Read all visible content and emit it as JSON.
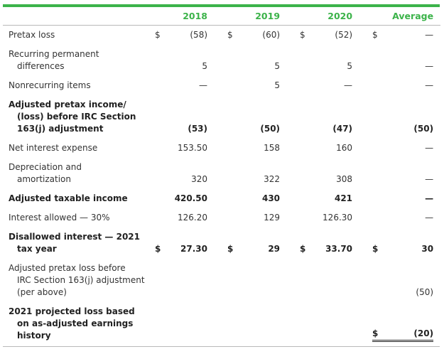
{
  "table": {
    "columns": [
      "2018",
      "2019",
      "2020",
      "Average"
    ],
    "header_color": "#3cb34a",
    "rows": [
      {
        "label_lines": [
          "Pretax loss"
        ],
        "bold": false,
        "cells": [
          {
            "dollar": "$",
            "value": "(58)"
          },
          {
            "dollar": "$",
            "value": "(60)"
          },
          {
            "dollar": "$",
            "value": "(52)"
          },
          {
            "dollar": "$",
            "value": "—"
          }
        ]
      },
      {
        "label_lines": [
          "Recurring permanent",
          "differences"
        ],
        "bold": false,
        "cells": [
          {
            "dollar": "",
            "value": "5"
          },
          {
            "dollar": "",
            "value": "5"
          },
          {
            "dollar": "",
            "value": "5"
          },
          {
            "dollar": "",
            "value": "—"
          }
        ]
      },
      {
        "label_lines": [
          "Nonrecurring items"
        ],
        "bold": false,
        "cells": [
          {
            "dollar": "",
            "value": "—"
          },
          {
            "dollar": "",
            "value": "5"
          },
          {
            "dollar": "",
            "value": "—"
          },
          {
            "dollar": "",
            "value": "—"
          }
        ]
      },
      {
        "label_lines": [
          "Adjusted pretax income/",
          "(loss) before IRC Section",
          "163(j) adjustment"
        ],
        "bold": true,
        "cells": [
          {
            "dollar": "",
            "value": "(53)"
          },
          {
            "dollar": "",
            "value": "(50)"
          },
          {
            "dollar": "",
            "value": "(47)"
          },
          {
            "dollar": "",
            "value": "(50)"
          }
        ]
      },
      {
        "label_lines": [
          "Net interest expense"
        ],
        "bold": false,
        "cells": [
          {
            "dollar": "",
            "value": "153.50"
          },
          {
            "dollar": "",
            "value": "158"
          },
          {
            "dollar": "",
            "value": "160"
          },
          {
            "dollar": "",
            "value": "—"
          }
        ]
      },
      {
        "label_lines": [
          "Depreciation and",
          "amortization"
        ],
        "bold": false,
        "cells": [
          {
            "dollar": "",
            "value": "320"
          },
          {
            "dollar": "",
            "value": "322"
          },
          {
            "dollar": "",
            "value": "308"
          },
          {
            "dollar": "",
            "value": "—"
          }
        ]
      },
      {
        "label_lines": [
          "Adjusted taxable income"
        ],
        "bold": true,
        "cells": [
          {
            "dollar": "",
            "value": "420.50"
          },
          {
            "dollar": "",
            "value": "430"
          },
          {
            "dollar": "",
            "value": "421"
          },
          {
            "dollar": "",
            "value": "—"
          }
        ]
      },
      {
        "label_lines": [
          "Interest allowed — 30%"
        ],
        "bold": false,
        "cells": [
          {
            "dollar": "",
            "value": "126.20"
          },
          {
            "dollar": "",
            "value": "129"
          },
          {
            "dollar": "",
            "value": "126.30"
          },
          {
            "dollar": "",
            "value": "—"
          }
        ]
      },
      {
        "label_lines": [
          "Disallowed interest — 2021",
          "tax year"
        ],
        "bold": true,
        "cells": [
          {
            "dollar": "$",
            "value": "27.30"
          },
          {
            "dollar": "$",
            "value": "29"
          },
          {
            "dollar": "$",
            "value": "33.70"
          },
          {
            "dollar": "$",
            "value": "30"
          }
        ]
      },
      {
        "label_lines": [
          "Adjusted pretax loss before",
          "IRC Section 163(j) adjustment",
          "(per above)"
        ],
        "bold": false,
        "cells": [
          {
            "dollar": "",
            "value": ""
          },
          {
            "dollar": "",
            "value": ""
          },
          {
            "dollar": "",
            "value": ""
          },
          {
            "dollar": "",
            "value": "(50)"
          }
        ]
      },
      {
        "label_lines": [
          "2021 projected loss based",
          "on as-adjusted earnings",
          "history"
        ],
        "bold": true,
        "double_underline_average": true,
        "cells": [
          {
            "dollar": "",
            "value": ""
          },
          {
            "dollar": "",
            "value": ""
          },
          {
            "dollar": "",
            "value": ""
          },
          {
            "dollar": "$",
            "value": "(20)"
          }
        ]
      }
    ]
  }
}
